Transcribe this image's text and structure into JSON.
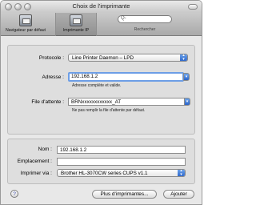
{
  "window": {
    "title": "Choix de l'imprimante"
  },
  "toolbar": {
    "default_browser_label": "Navigateur par défaut",
    "ip_printer_label": "Imprimante IP",
    "search_placeholder": "Q-",
    "search_label": "Rechercher"
  },
  "connection": {
    "protocol_label": "Protocole :",
    "protocol_value": "Line Printer Daemon – LPD",
    "address_label": "Adresse :",
    "address_value": "192.168.1.2",
    "address_hint": "Adresse complète et valide.",
    "queue_label": "File d'attente :",
    "queue_value": "BRNxxxxxxxxxxxx_AT",
    "queue_hint": "Ne pas remplir la file d'attente par défaut."
  },
  "details": {
    "name_label": "Nom :",
    "name_value": "192.168.1.2",
    "location_label": "Emplacement :",
    "location_value": "",
    "print_via_label": "Imprimer via :",
    "print_via_value": "Brother HL-3070CW series CUPS v1.1"
  },
  "footer": {
    "help_glyph": "?",
    "more_printers_label": "Plus d'imprimantes...",
    "add_label": "Ajouter"
  },
  "colors": {
    "focus_ring": "#6d9ee6",
    "popup_arrow": "#2a63c9"
  }
}
